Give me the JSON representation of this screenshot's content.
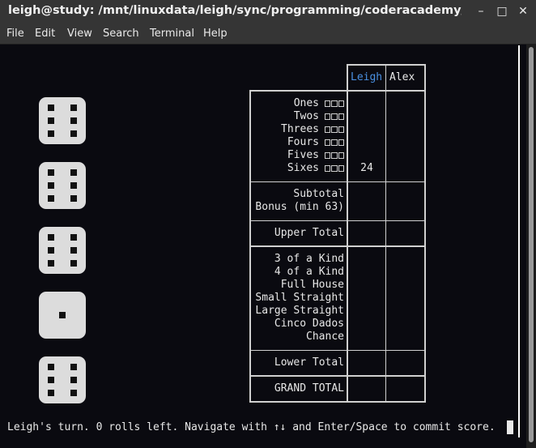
{
  "window": {
    "title": "leigh@study: /mnt/linuxdata/leigh/sync/programming/coderacademy/te...",
    "minimize": "–",
    "maximize": "□",
    "close": "✕"
  },
  "menu": [
    "File",
    "Edit",
    "View",
    "Search",
    "Terminal",
    "Help"
  ],
  "dice": [
    6,
    6,
    6,
    1,
    6
  ],
  "players": [
    {
      "name": "Leigh",
      "color": "#4a90e2"
    },
    {
      "name": "Alex",
      "color": "#e8e8e8"
    }
  ],
  "upper_rows": [
    "Ones",
    "Twos",
    "Threes",
    "Fours",
    "Fives",
    "Sixes"
  ],
  "subtotal_label": "Subtotal",
  "bonus_label": "Bonus (min 63)",
  "upper_total_label": "Upper Total",
  "lower_rows": [
    "3 of a Kind",
    "4 of a Kind",
    "Full House",
    "Small Straight",
    "Large Straight",
    "Cinco Dados",
    "Chance"
  ],
  "lower_total_label": "Lower Total",
  "grand_total_label": "GRAND TOTAL",
  "scores": {
    "leigh_sixes": "24"
  },
  "status": "Leigh's turn. 0 rolls left. Navigate with ↑↓ and Enter/Space to commit score."
}
